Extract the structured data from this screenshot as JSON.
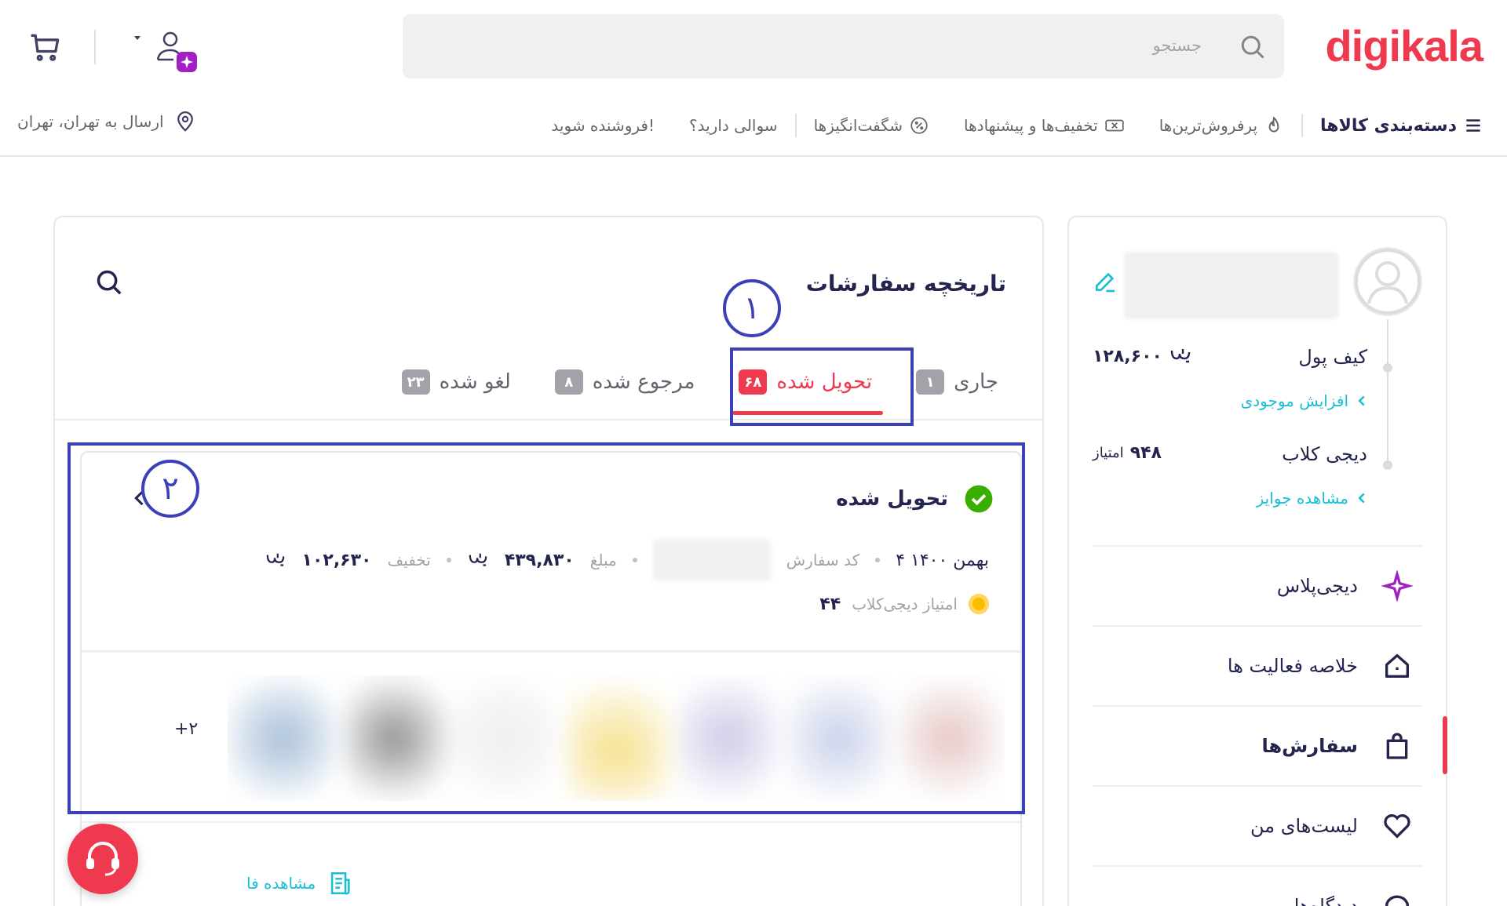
{
  "header": {
    "logo": "digikala",
    "search_placeholder": "جستجو"
  },
  "nav": {
    "categories": "دسته‌بندی کالاها",
    "items": [
      "پرفروش‌ترین‌ها",
      "تخفیف‌ها و پیشنهادها",
      "شگفت‌انگیزها",
      "سوالی دارید؟",
      "فروشنده شوید!"
    ],
    "location": "ارسال به تهران، تهران"
  },
  "sidebar": {
    "wallet_label": "کیف پول",
    "wallet_value": "۱۲۸,۶۰۰",
    "wallet_link": "افزایش موجودی",
    "club_label": "دیجی کلاب",
    "club_value": "۹۴۸",
    "club_unit": "امتیاز",
    "club_link": "مشاهده جوایز",
    "menu": [
      "دیجی‌پلاس",
      "خلاصه فعالیت ها",
      "سفارش‌ها",
      "لیست‌های من",
      "دیدگاه‌ها"
    ]
  },
  "main": {
    "title": "تاریخچه سفارشات",
    "tabs": [
      {
        "label": "جاری",
        "count": "۱"
      },
      {
        "label": "تحویل شده",
        "count": "۶۸"
      },
      {
        "label": "مرجوع شده",
        "count": "۸"
      },
      {
        "label": "لغو شده",
        "count": "۲۳"
      }
    ]
  },
  "order": {
    "status": "تحویل شده",
    "date": "۴ بهمن ۱۴۰۰",
    "code_label": "کد سفارش",
    "amount_label": "مبلغ",
    "amount_value": "۴۳۹,۸۳۰",
    "discount_label": "تخفیف",
    "discount_value": "۱۰۲,۶۳۰",
    "points_label": "امتیاز دیجی‌کلاب",
    "points_value": "۴۴",
    "more": "+۲",
    "invoice": "مشاهده فا"
  },
  "annotations": {
    "one": "۱",
    "two": "۲"
  },
  "colors": {
    "brand": "#ef394e",
    "link": "#19bfd3",
    "annotation": "#3b3fb8"
  }
}
